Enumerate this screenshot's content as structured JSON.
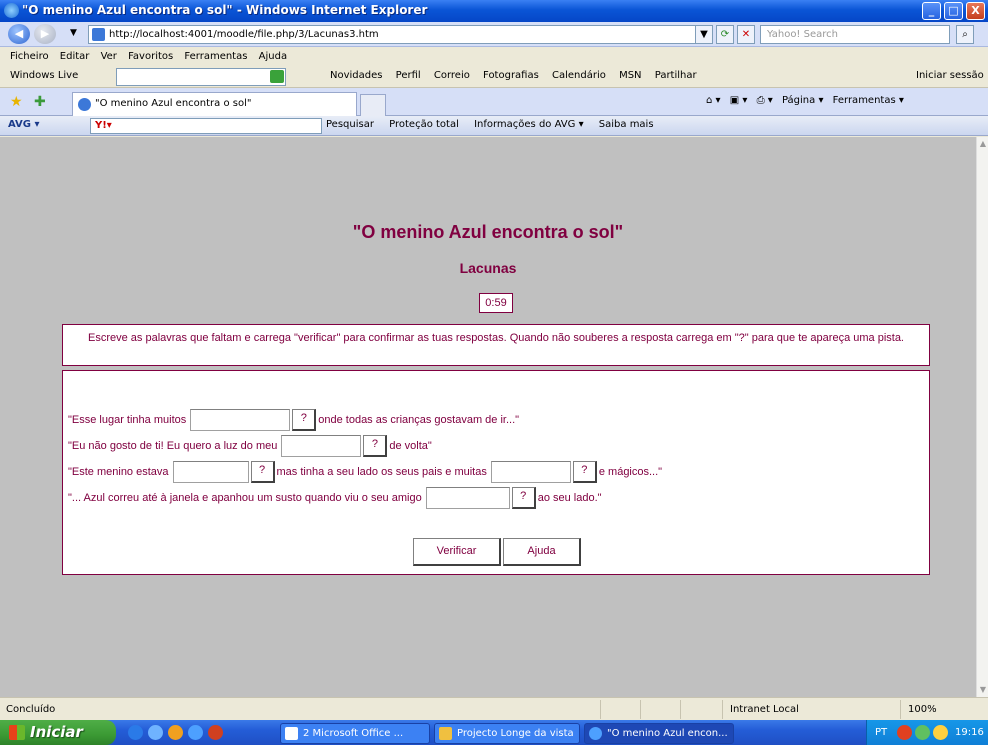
{
  "window": {
    "title": "\"O menino Azul encontra o sol\" - Windows Internet Explorer",
    "controls": {
      "minimize": "_",
      "maximize": "□",
      "close": "X"
    }
  },
  "address_bar": {
    "url": "http://localhost:4001/moodle/file.php/3/Lacunas3.htm",
    "search_placeholder": "Yahoo! Search"
  },
  "menu": {
    "items": [
      "Ficheiro",
      "Editar",
      "Ver",
      "Favoritos",
      "Ferramentas",
      "Ajuda"
    ]
  },
  "windows_live": {
    "label": "Windows Live",
    "links": [
      "Novidades",
      "Perfil",
      "Correio",
      "Fotografias",
      "Calendário",
      "MSN",
      "Partilhar"
    ],
    "login": "Iniciar sessão"
  },
  "tabs": {
    "active_tab": "\"O menino Azul encontra o sol\"",
    "tools": [
      "Página ▾",
      "Ferramentas ▾"
    ]
  },
  "avg_toolbar": {
    "brand": "AVG ▾",
    "search_text": "Y!▾",
    "items": [
      "Pesquisar",
      "Proteção total",
      "Informações do AVG ▾",
      "Saiba mais"
    ]
  },
  "page": {
    "title": "\"O menino Azul encontra o sol\"",
    "subtitle": "Lacunas",
    "timer": "0:59",
    "instructions": "Escreve as palavras que faltam e carrega \"verificar\" para confirmar as tuas respostas. Quando não souberes a resposta carrega em \"?\" para que te apareça uma pista.",
    "hint_label": "?",
    "sentences": [
      {
        "before": "\"Esse lugar tinha muitos",
        "after": "onde todas as crianças gostavam de ir...\""
      },
      {
        "before": "\"Eu não gosto de ti! Eu quero a luz do meu",
        "after": "de volta\""
      },
      {
        "before": "\"Este menino estava",
        "middle": "mas tinha a seu lado os seus pais e muitas",
        "after": "e mágicos...\""
      },
      {
        "before": "\"... Azul correu até à janela e apanhou um susto quando viu o seu amigo",
        "after": "ao seu lado.\""
      }
    ],
    "check_button": "Verificar",
    "help_button": "Ajuda"
  },
  "status_bar": {
    "status": "Concluído",
    "zone": "Intranet Local",
    "zoom": "100%"
  },
  "taskbar": {
    "start": "Iniciar",
    "items": [
      "2 Microsoft Office ...",
      "Projecto Longe da vista",
      "\"O menino Azul encon..."
    ],
    "language": "PT",
    "clock": "19:16"
  }
}
